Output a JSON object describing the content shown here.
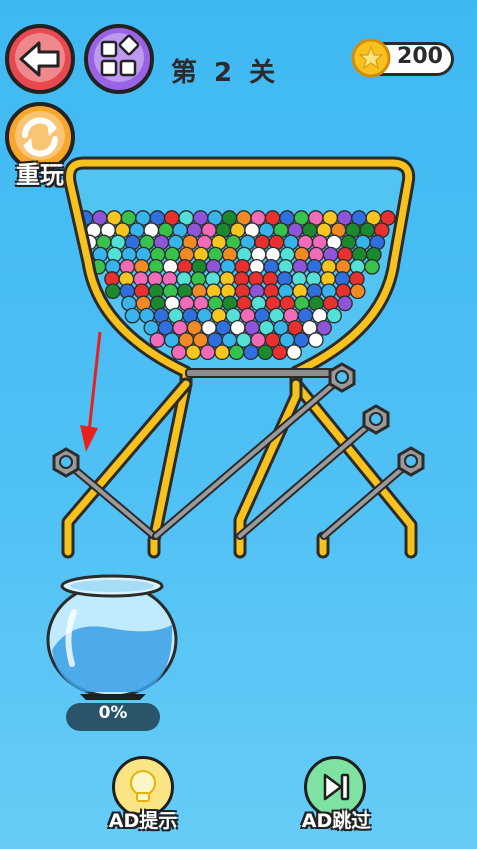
{
  "header": {
    "level_title": "第 2 关",
    "coins": "200",
    "replay_label": "重玩"
  },
  "icons": {
    "back": "back-arrow-icon",
    "levels": "level-grid-icon",
    "replay": "replay-icon",
    "coin": "star-coin-icon",
    "hint": "lightbulb-icon",
    "skip": "skip-forward-icon"
  },
  "jar": {
    "progress_label": "0%",
    "progress": 0
  },
  "actions": {
    "hint_label": "AD提示",
    "skip_label": "AD跳过"
  },
  "colors": {
    "background": "#4ec0f4",
    "funnel": "#f7c21d",
    "pin": "#8c8c8c",
    "tutorial_arrow": "#e8201e"
  },
  "balls": {
    "palette": [
      "#e8302e",
      "#f7c520",
      "#36c24b",
      "#1b8a2f",
      "#37b4ec",
      "#2f6fe0",
      "#8e55db",
      "#f26bb8",
      "#f08a24",
      "#52e0d7",
      "#ffffff"
    ]
  }
}
